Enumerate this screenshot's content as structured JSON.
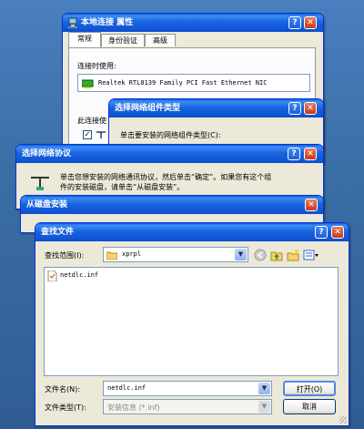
{
  "local_props": {
    "title": "本地连接 属性",
    "tabs": [
      "常规",
      "身份验证",
      "高级"
    ],
    "connect_using_label": "连接时使用:",
    "adapter_name": "Realtek RTL8139 Family PCI Fast Ethernet NIC",
    "this_connection_label": "此连接使"
  },
  "component_type": {
    "title": "选择网络组件类型",
    "prompt": "单击要安装的网络组件类型(C):"
  },
  "select_protocol": {
    "title": "选择网络协议",
    "desc_line1": "单击您想安装的网络通讯协议，然后单击“确定”。如果您有这个组",
    "desc_line2": "件的安装磁盘，请单击“从磁盘安装”。"
  },
  "install_from_disk": {
    "title": "从磁盘安装"
  },
  "find_file": {
    "title": "查找文件",
    "look_in_label": "查找范围(I):",
    "look_in_value": "xprpl",
    "files": [
      "netdlc.inf"
    ],
    "file_name_label": "文件名(N):",
    "file_name_value": "netdlc.inf",
    "file_type_label": "文件类型(T):",
    "file_type_value": "安装信息 (*.inf)",
    "open_button": "打开(O)",
    "cancel_button": "取消"
  },
  "window_buttons": {
    "help": "?",
    "close": "✕"
  },
  "colors": {
    "titlebar": "#0c4fd0",
    "dialog_bg": "#ece9d8",
    "desktop": "#3a6ea5"
  }
}
